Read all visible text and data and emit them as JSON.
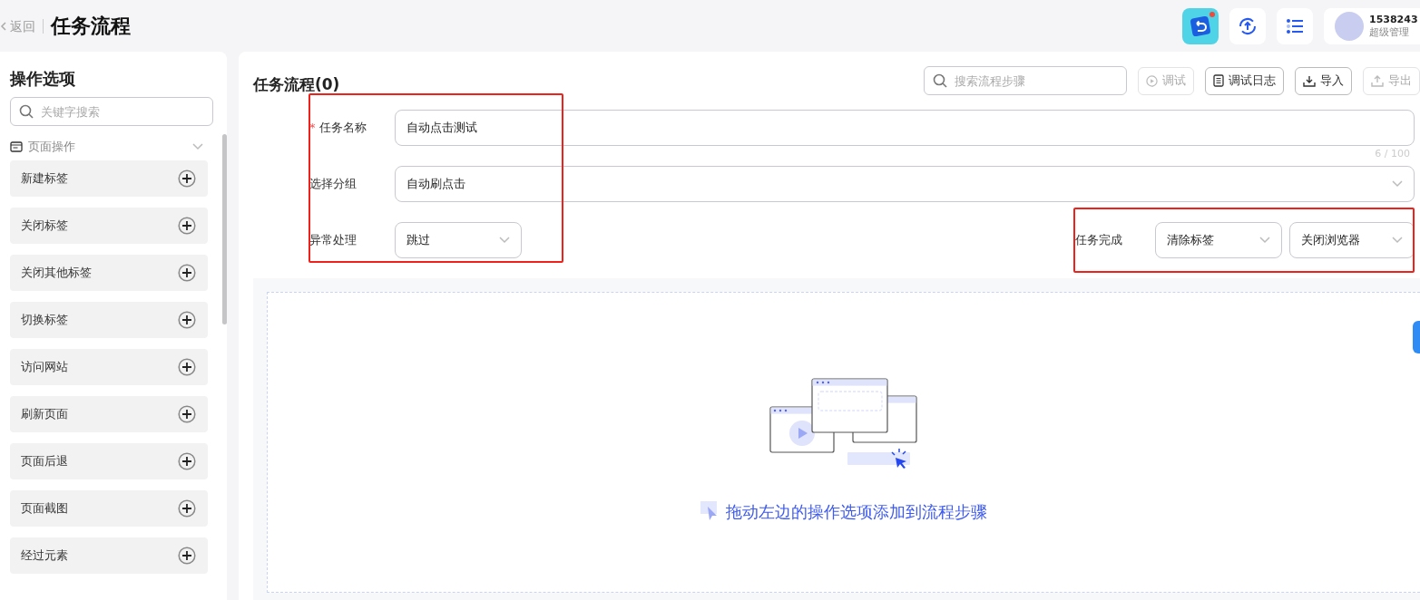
{
  "header": {
    "back": "返回",
    "title": "任务流程",
    "user": {
      "name": "1538243",
      "role": "超级管理"
    },
    "notification_dot": true
  },
  "sidebar": {
    "title": "操作选项",
    "search": {
      "placeholder": "关键字搜索"
    },
    "group": {
      "label": "页面操作",
      "expanded": true
    },
    "items": [
      {
        "label": "新建标签"
      },
      {
        "label": "关闭标签"
      },
      {
        "label": "关闭其他标签"
      },
      {
        "label": "切换标签"
      },
      {
        "label": "访问网站"
      },
      {
        "label": "刷新页面"
      },
      {
        "label": "页面后退"
      },
      {
        "label": "页面截图"
      },
      {
        "label": "经过元素"
      }
    ]
  },
  "main": {
    "title": "任务流程(0)",
    "search": {
      "placeholder": "搜索流程步骤"
    },
    "buttons": [
      {
        "label": "调试",
        "kind": "play",
        "disabled": true
      },
      {
        "label": "调试日志",
        "kind": "log",
        "disabled": false
      },
      {
        "label": "导入",
        "kind": "import",
        "disabled": false
      },
      {
        "label": "导出",
        "kind": "export",
        "disabled": true
      }
    ],
    "form": {
      "name": {
        "label": "任务名称",
        "required_mark": "*",
        "value": "自动点击测试",
        "counter": "6 / 100"
      },
      "group": {
        "label": "选择分组",
        "value": "自动刷点击"
      },
      "error": {
        "label": "异常处理",
        "value": "跳过"
      },
      "finish": {
        "label": "任务完成",
        "values": [
          "清除标签",
          "关闭浏览器"
        ]
      }
    },
    "empty_hint": "拖动左边的操作选项添加到流程步骤"
  }
}
